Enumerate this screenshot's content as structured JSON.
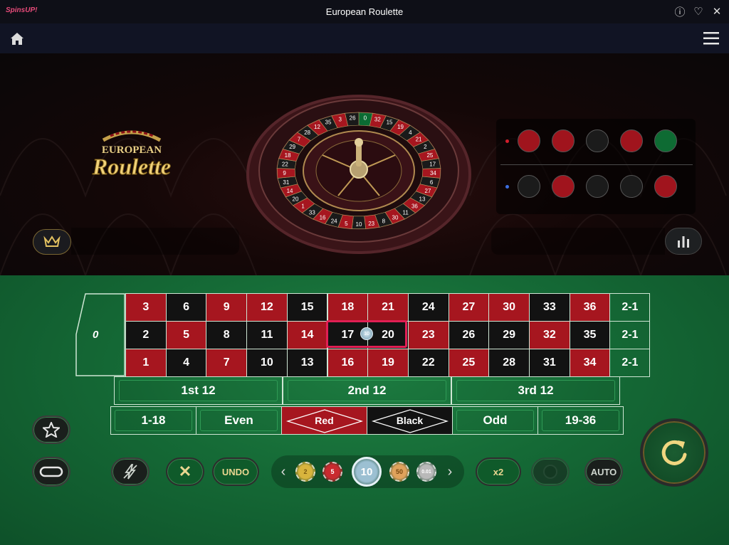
{
  "app": {
    "brand": "SpinsUP!",
    "title": "European Roulette"
  },
  "title_icons": [
    "info-icon",
    "heart-icon",
    "close-icon"
  ],
  "logo": {
    "line1": "EUROPEAN",
    "line2": "Roulette"
  },
  "wheel_numbers": [
    "0",
    "32",
    "15",
    "19",
    "4",
    "21",
    "2",
    "25",
    "17",
    "34",
    "6",
    "27",
    "13",
    "36",
    "11",
    "30",
    "8",
    "23",
    "10",
    "5",
    "24",
    "16",
    "33",
    "1",
    "20",
    "14",
    "31",
    "9",
    "22",
    "18",
    "29",
    "7",
    "28",
    "12",
    "35",
    "3",
    "26"
  ],
  "history": {
    "row1": [
      "red",
      "red",
      "black",
      "red",
      "green"
    ],
    "row2": [
      "black",
      "red",
      "black",
      "black",
      "red"
    ],
    "row1_marker": "#d21d2b",
    "row2_marker": "#3c6ee0"
  },
  "colors": {
    "red": "#a6161f",
    "black": "#1a1a1a",
    "green": "#0b6b33",
    "felt": "#1a7a3e",
    "highlight": "#e11f54",
    "gold": "#e9d690"
  },
  "board": {
    "zero": "0",
    "rows": [
      [
        {
          "n": "3",
          "c": "red"
        },
        {
          "n": "6",
          "c": "black"
        },
        {
          "n": "9",
          "c": "red"
        },
        {
          "n": "12",
          "c": "red"
        },
        {
          "n": "15",
          "c": "black"
        },
        {
          "n": "18",
          "c": "red"
        },
        {
          "n": "21",
          "c": "red"
        },
        {
          "n": "24",
          "c": "black"
        },
        {
          "n": "27",
          "c": "red"
        },
        {
          "n": "30",
          "c": "red"
        },
        {
          "n": "33",
          "c": "black"
        },
        {
          "n": "36",
          "c": "red"
        }
      ],
      [
        {
          "n": "2",
          "c": "black"
        },
        {
          "n": "5",
          "c": "red"
        },
        {
          "n": "8",
          "c": "black"
        },
        {
          "n": "11",
          "c": "black"
        },
        {
          "n": "14",
          "c": "red"
        },
        {
          "n": "17",
          "c": "black"
        },
        {
          "n": "20",
          "c": "black"
        },
        {
          "n": "23",
          "c": "red"
        },
        {
          "n": "26",
          "c": "black"
        },
        {
          "n": "29",
          "c": "black"
        },
        {
          "n": "32",
          "c": "red"
        },
        {
          "n": "35",
          "c": "black"
        }
      ],
      [
        {
          "n": "1",
          "c": "red"
        },
        {
          "n": "4",
          "c": "black"
        },
        {
          "n": "7",
          "c": "red"
        },
        {
          "n": "10",
          "c": "black"
        },
        {
          "n": "13",
          "c": "black"
        },
        {
          "n": "16",
          "c": "red"
        },
        {
          "n": "19",
          "c": "red"
        },
        {
          "n": "22",
          "c": "black"
        },
        {
          "n": "25",
          "c": "red"
        },
        {
          "n": "28",
          "c": "black"
        },
        {
          "n": "31",
          "c": "black"
        },
        {
          "n": "34",
          "c": "red"
        }
      ]
    ],
    "columns": [
      "2-1",
      "2-1",
      "2-1"
    ],
    "dozens": [
      "1st 12",
      "2nd 12",
      "3rd 12"
    ],
    "outside": [
      "1-18",
      "Even",
      "Red",
      "Black",
      "Odd",
      "19-36"
    ],
    "placed_chip": "10"
  },
  "controls": {
    "undo": "UNDO",
    "double": "x2",
    "auto": "AUTO",
    "chips": [
      {
        "label": "2",
        "bg": "#d8b43d",
        "fg": "#7a5a10"
      },
      {
        "label": "5",
        "bg": "#c92a2f",
        "fg": "#fff"
      },
      {
        "label": "10",
        "bg": "#9cc0d2",
        "fg": "#fff"
      },
      {
        "label": "50",
        "bg": "#e0a25c",
        "fg": "#7a4a12"
      },
      {
        "label": "0.01",
        "bg": "#b9b9b9",
        "fg": "#fff"
      }
    ]
  }
}
